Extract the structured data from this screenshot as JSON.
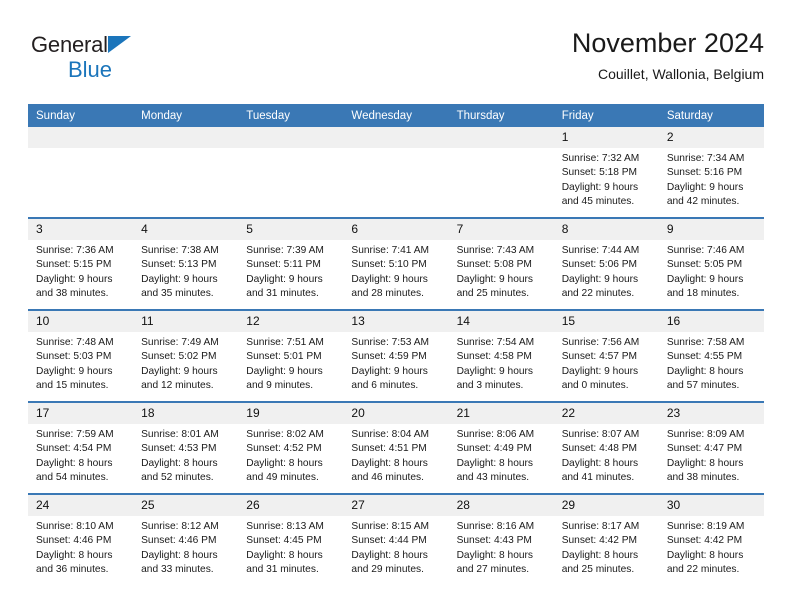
{
  "brand": {
    "name_top": "General",
    "name_bottom": "Blue",
    "triangle_icon": "triangle-icon",
    "accent_color": "#1b75bb"
  },
  "header": {
    "title": "November 2024",
    "subtitle": "Couillet, Wallonia, Belgium"
  },
  "theme": {
    "header_blue": "#3a78b5",
    "daynum_band": "#f0f0f0",
    "text": "#1a1a1a"
  },
  "calendar": {
    "weekday_headers": [
      "Sunday",
      "Monday",
      "Tuesday",
      "Wednesday",
      "Thursday",
      "Friday",
      "Saturday"
    ],
    "weeks": [
      [
        {
          "day": "",
          "empty": true
        },
        {
          "day": "",
          "empty": true
        },
        {
          "day": "",
          "empty": true
        },
        {
          "day": "",
          "empty": true
        },
        {
          "day": "",
          "empty": true
        },
        {
          "day": "1",
          "sunrise": "Sunrise: 7:32 AM",
          "sunset": "Sunset: 5:18 PM",
          "daylight_l1": "Daylight: 9 hours",
          "daylight_l2": "and 45 minutes."
        },
        {
          "day": "2",
          "sunrise": "Sunrise: 7:34 AM",
          "sunset": "Sunset: 5:16 PM",
          "daylight_l1": "Daylight: 9 hours",
          "daylight_l2": "and 42 minutes."
        }
      ],
      [
        {
          "day": "3",
          "sunrise": "Sunrise: 7:36 AM",
          "sunset": "Sunset: 5:15 PM",
          "daylight_l1": "Daylight: 9 hours",
          "daylight_l2": "and 38 minutes."
        },
        {
          "day": "4",
          "sunrise": "Sunrise: 7:38 AM",
          "sunset": "Sunset: 5:13 PM",
          "daylight_l1": "Daylight: 9 hours",
          "daylight_l2": "and 35 minutes."
        },
        {
          "day": "5",
          "sunrise": "Sunrise: 7:39 AM",
          "sunset": "Sunset: 5:11 PM",
          "daylight_l1": "Daylight: 9 hours",
          "daylight_l2": "and 31 minutes."
        },
        {
          "day": "6",
          "sunrise": "Sunrise: 7:41 AM",
          "sunset": "Sunset: 5:10 PM",
          "daylight_l1": "Daylight: 9 hours",
          "daylight_l2": "and 28 minutes."
        },
        {
          "day": "7",
          "sunrise": "Sunrise: 7:43 AM",
          "sunset": "Sunset: 5:08 PM",
          "daylight_l1": "Daylight: 9 hours",
          "daylight_l2": "and 25 minutes."
        },
        {
          "day": "8",
          "sunrise": "Sunrise: 7:44 AM",
          "sunset": "Sunset: 5:06 PM",
          "daylight_l1": "Daylight: 9 hours",
          "daylight_l2": "and 22 minutes."
        },
        {
          "day": "9",
          "sunrise": "Sunrise: 7:46 AM",
          "sunset": "Sunset: 5:05 PM",
          "daylight_l1": "Daylight: 9 hours",
          "daylight_l2": "and 18 minutes."
        }
      ],
      [
        {
          "day": "10",
          "sunrise": "Sunrise: 7:48 AM",
          "sunset": "Sunset: 5:03 PM",
          "daylight_l1": "Daylight: 9 hours",
          "daylight_l2": "and 15 minutes."
        },
        {
          "day": "11",
          "sunrise": "Sunrise: 7:49 AM",
          "sunset": "Sunset: 5:02 PM",
          "daylight_l1": "Daylight: 9 hours",
          "daylight_l2": "and 12 minutes."
        },
        {
          "day": "12",
          "sunrise": "Sunrise: 7:51 AM",
          "sunset": "Sunset: 5:01 PM",
          "daylight_l1": "Daylight: 9 hours",
          "daylight_l2": "and 9 minutes."
        },
        {
          "day": "13",
          "sunrise": "Sunrise: 7:53 AM",
          "sunset": "Sunset: 4:59 PM",
          "daylight_l1": "Daylight: 9 hours",
          "daylight_l2": "and 6 minutes."
        },
        {
          "day": "14",
          "sunrise": "Sunrise: 7:54 AM",
          "sunset": "Sunset: 4:58 PM",
          "daylight_l1": "Daylight: 9 hours",
          "daylight_l2": "and 3 minutes."
        },
        {
          "day": "15",
          "sunrise": "Sunrise: 7:56 AM",
          "sunset": "Sunset: 4:57 PM",
          "daylight_l1": "Daylight: 9 hours",
          "daylight_l2": "and 0 minutes."
        },
        {
          "day": "16",
          "sunrise": "Sunrise: 7:58 AM",
          "sunset": "Sunset: 4:55 PM",
          "daylight_l1": "Daylight: 8 hours",
          "daylight_l2": "and 57 minutes."
        }
      ],
      [
        {
          "day": "17",
          "sunrise": "Sunrise: 7:59 AM",
          "sunset": "Sunset: 4:54 PM",
          "daylight_l1": "Daylight: 8 hours",
          "daylight_l2": "and 54 minutes."
        },
        {
          "day": "18",
          "sunrise": "Sunrise: 8:01 AM",
          "sunset": "Sunset: 4:53 PM",
          "daylight_l1": "Daylight: 8 hours",
          "daylight_l2": "and 52 minutes."
        },
        {
          "day": "19",
          "sunrise": "Sunrise: 8:02 AM",
          "sunset": "Sunset: 4:52 PM",
          "daylight_l1": "Daylight: 8 hours",
          "daylight_l2": "and 49 minutes."
        },
        {
          "day": "20",
          "sunrise": "Sunrise: 8:04 AM",
          "sunset": "Sunset: 4:51 PM",
          "daylight_l1": "Daylight: 8 hours",
          "daylight_l2": "and 46 minutes."
        },
        {
          "day": "21",
          "sunrise": "Sunrise: 8:06 AM",
          "sunset": "Sunset: 4:49 PM",
          "daylight_l1": "Daylight: 8 hours",
          "daylight_l2": "and 43 minutes."
        },
        {
          "day": "22",
          "sunrise": "Sunrise: 8:07 AM",
          "sunset": "Sunset: 4:48 PM",
          "daylight_l1": "Daylight: 8 hours",
          "daylight_l2": "and 41 minutes."
        },
        {
          "day": "23",
          "sunrise": "Sunrise: 8:09 AM",
          "sunset": "Sunset: 4:47 PM",
          "daylight_l1": "Daylight: 8 hours",
          "daylight_l2": "and 38 minutes."
        }
      ],
      [
        {
          "day": "24",
          "sunrise": "Sunrise: 8:10 AM",
          "sunset": "Sunset: 4:46 PM",
          "daylight_l1": "Daylight: 8 hours",
          "daylight_l2": "and 36 minutes."
        },
        {
          "day": "25",
          "sunrise": "Sunrise: 8:12 AM",
          "sunset": "Sunset: 4:46 PM",
          "daylight_l1": "Daylight: 8 hours",
          "daylight_l2": "and 33 minutes."
        },
        {
          "day": "26",
          "sunrise": "Sunrise: 8:13 AM",
          "sunset": "Sunset: 4:45 PM",
          "daylight_l1": "Daylight: 8 hours",
          "daylight_l2": "and 31 minutes."
        },
        {
          "day": "27",
          "sunrise": "Sunrise: 8:15 AM",
          "sunset": "Sunset: 4:44 PM",
          "daylight_l1": "Daylight: 8 hours",
          "daylight_l2": "and 29 minutes."
        },
        {
          "day": "28",
          "sunrise": "Sunrise: 8:16 AM",
          "sunset": "Sunset: 4:43 PM",
          "daylight_l1": "Daylight: 8 hours",
          "daylight_l2": "and 27 minutes."
        },
        {
          "day": "29",
          "sunrise": "Sunrise: 8:17 AM",
          "sunset": "Sunset: 4:42 PM",
          "daylight_l1": "Daylight: 8 hours",
          "daylight_l2": "and 25 minutes."
        },
        {
          "day": "30",
          "sunrise": "Sunrise: 8:19 AM",
          "sunset": "Sunset: 4:42 PM",
          "daylight_l1": "Daylight: 8 hours",
          "daylight_l2": "and 22 minutes."
        }
      ]
    ]
  }
}
